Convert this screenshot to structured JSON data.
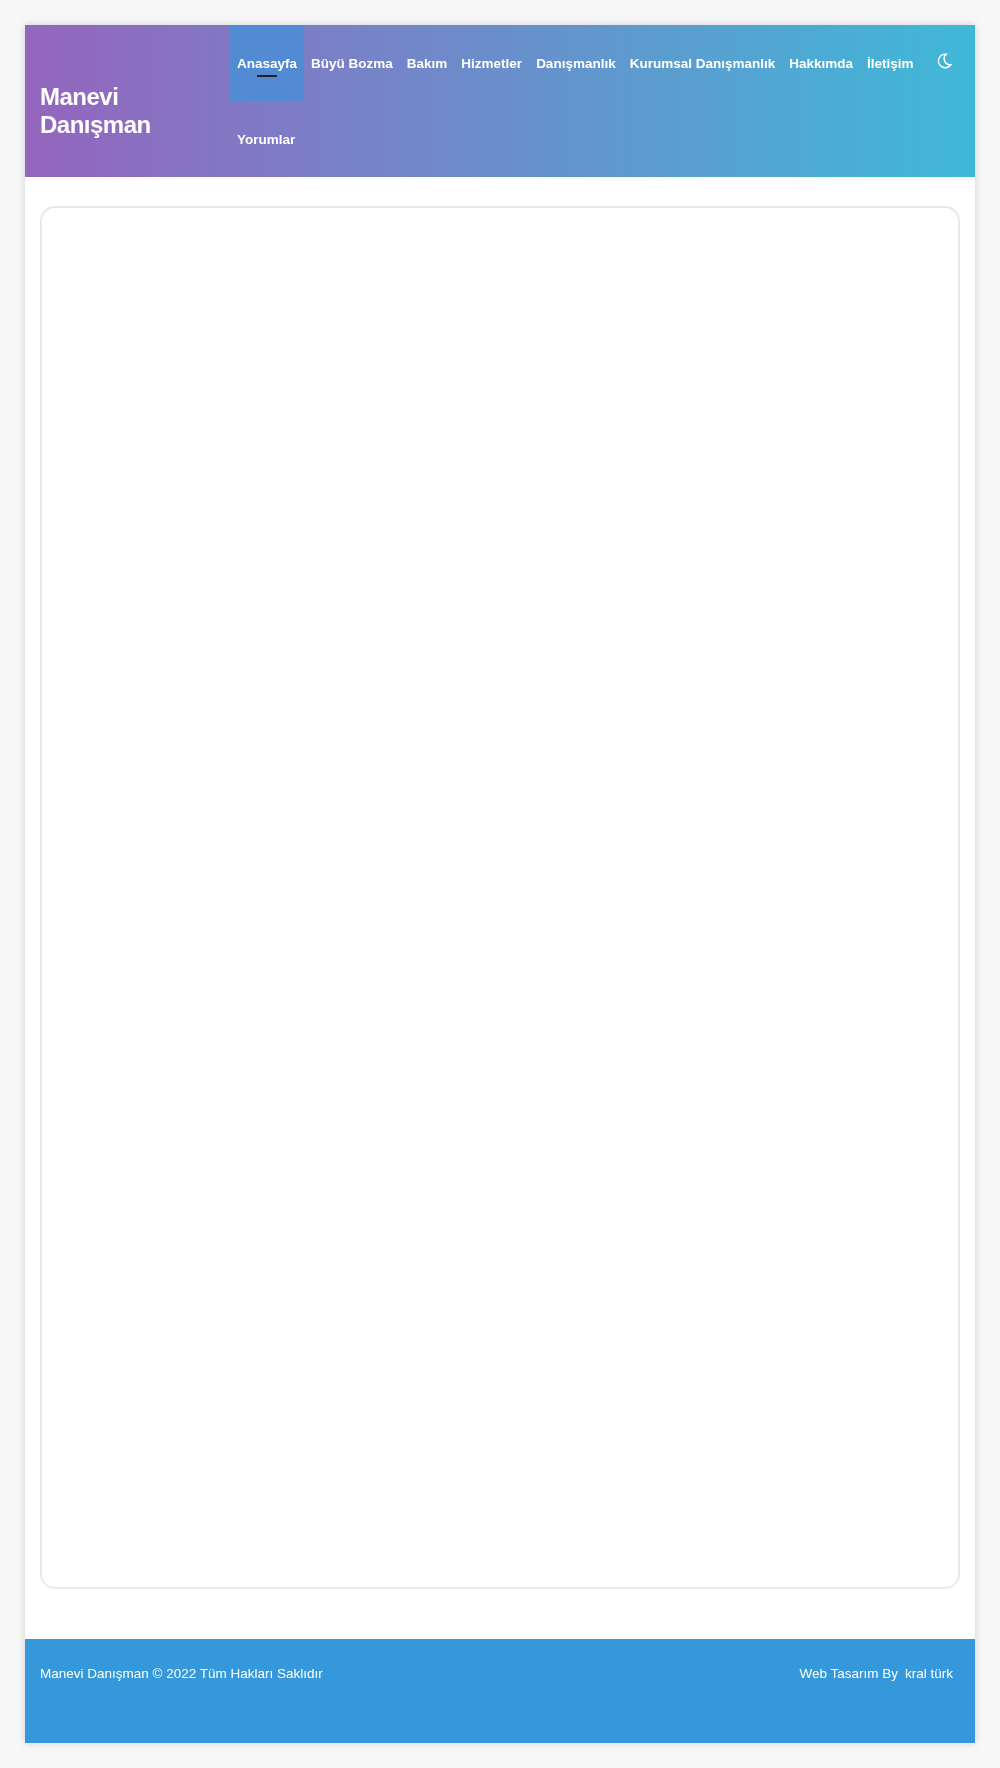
{
  "header": {
    "logo": "Manevi Danışman",
    "nav": [
      {
        "label": "Anasayfa",
        "selected": true
      },
      {
        "label": "Büyü Bozma",
        "selected": false
      },
      {
        "label": "Bakım",
        "selected": false
      },
      {
        "label": "Hizmetler",
        "selected": false
      },
      {
        "label": "Danışmanlık",
        "selected": false
      },
      {
        "label": "Kurumsal Danışmanlık",
        "selected": false
      },
      {
        "label": "Hakkımda",
        "selected": false
      },
      {
        "label": "İletişim",
        "selected": false
      },
      {
        "label": "Yorumlar",
        "selected": false
      }
    ]
  },
  "footer": {
    "copyright": "Manevi Danışman © 2022 Tüm Hakları Saklıdır",
    "credit": "Web Tasarım By",
    "credit_link": "kral türk"
  }
}
